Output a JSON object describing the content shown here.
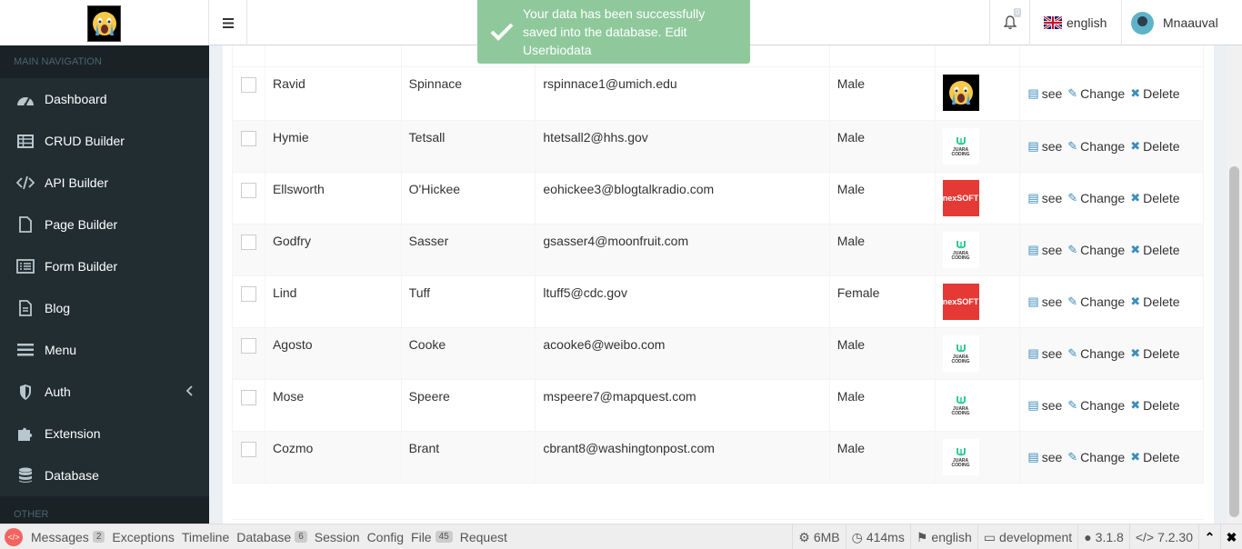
{
  "header": {
    "notification_count": "0",
    "language": "english",
    "username": "Mnaauval"
  },
  "toast": {
    "message": "Your data has been successfully saved into the database. Edit Userbiodata"
  },
  "sidebar": {
    "section_main": "MAIN NAVIGATION",
    "section_other": "OTHER",
    "items": [
      {
        "label": "Dashboard",
        "icon": "dashboard-icon"
      },
      {
        "label": "CRUD Builder",
        "icon": "table-icon"
      },
      {
        "label": "API Builder",
        "icon": "code-icon"
      },
      {
        "label": "Page Builder",
        "icon": "file-icon"
      },
      {
        "label": "Form Builder",
        "icon": "list-alt-icon"
      },
      {
        "label": "Blog",
        "icon": "file-text-icon"
      },
      {
        "label": "Menu",
        "icon": "bars-icon"
      },
      {
        "label": "Auth",
        "icon": "shield-icon"
      },
      {
        "label": "Extension",
        "icon": "puzzle-icon"
      },
      {
        "label": "Database",
        "icon": "database-icon"
      }
    ]
  },
  "table": {
    "rows": [
      {
        "first": "Ravid",
        "last": "Spinnace",
        "email": "rspinnace1@umich.edu",
        "gender": "Male",
        "image": "cry"
      },
      {
        "first": "Hymie",
        "last": "Tetsall",
        "email": "htetsall2@hhs.gov",
        "gender": "Male",
        "image": "juara"
      },
      {
        "first": "Ellsworth",
        "last": "O'Hickee",
        "email": "eohickee3@blogtalkradio.com",
        "gender": "Male",
        "image": "nexsoft"
      },
      {
        "first": "Godfry",
        "last": "Sasser",
        "email": "gsasser4@moonfruit.com",
        "gender": "Male",
        "image": "juara"
      },
      {
        "first": "Lind",
        "last": "Tuff",
        "email": "ltuff5@cdc.gov",
        "gender": "Female",
        "image": "nexsoft"
      },
      {
        "first": "Agosto",
        "last": "Cooke",
        "email": "acooke6@weibo.com",
        "gender": "Male",
        "image": "juara"
      },
      {
        "first": "Mose",
        "last": "Speere",
        "email": "mspeere7@mapquest.com",
        "gender": "Male",
        "image": "juara"
      },
      {
        "first": "Cozmo",
        "last": "Brant",
        "email": "cbrant8@washingtonpost.com",
        "gender": "Male",
        "image": "juara"
      }
    ],
    "actions": {
      "see": "see",
      "change": "Change",
      "delete": "Delete"
    },
    "logo_text": {
      "nexsoft": "nexSOFT",
      "juara_top": "JUARA",
      "juara_bottom": "CODING"
    }
  },
  "debugbar": {
    "tabs": [
      {
        "label": "Messages",
        "badge": "2"
      },
      {
        "label": "Exceptions",
        "badge": ""
      },
      {
        "label": "Timeline",
        "badge": ""
      },
      {
        "label": "Database",
        "badge": "6"
      },
      {
        "label": "Session",
        "badge": ""
      },
      {
        "label": "Config",
        "badge": ""
      },
      {
        "label": "File",
        "badge": "45"
      },
      {
        "label": "Request",
        "badge": ""
      }
    ],
    "memory": "6MB",
    "time": "414ms",
    "locale": "english",
    "env": "development",
    "version": "3.1.8",
    "php": "7.2.30"
  }
}
